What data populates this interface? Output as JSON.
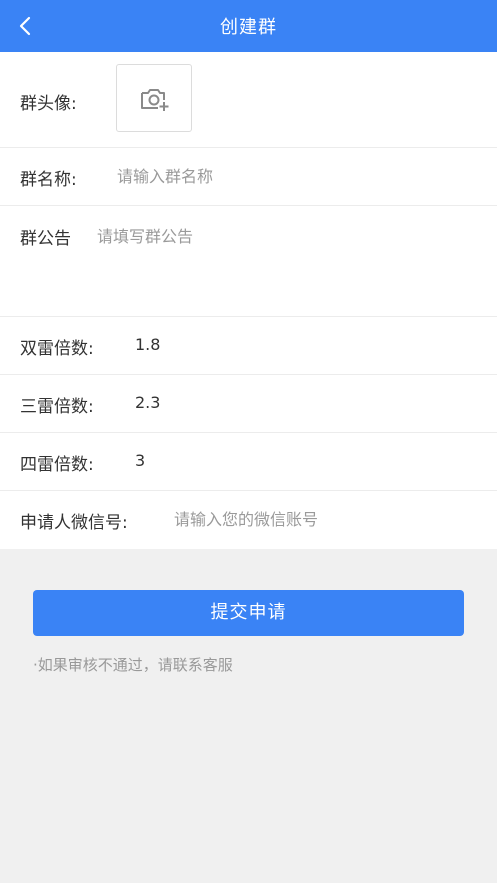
{
  "header": {
    "title": "创建群",
    "back_icon": "chevron-left-icon"
  },
  "form": {
    "avatar": {
      "label": "群头像:",
      "icon": "camera-plus-icon"
    },
    "name": {
      "label": "群名称:",
      "placeholder": "请输入群名称"
    },
    "notice": {
      "label": "群公告",
      "placeholder": "请填写群公告"
    },
    "double_multiplier": {
      "label": "双雷倍数:",
      "value": "1.8"
    },
    "triple_multiplier": {
      "label": "三雷倍数:",
      "value": "2.3"
    },
    "quad_multiplier": {
      "label": "四雷倍数:",
      "value": "3"
    },
    "applicant_wechat": {
      "label": "申请人微信号:",
      "placeholder": "请输入您的微信账号"
    }
  },
  "submit_label": "提交申请",
  "note": "·如果审核不通过，请联系客服",
  "colors": {
    "primary": "#3a83f5",
    "background": "#f0f0f0",
    "placeholder": "#9a9a9a"
  }
}
